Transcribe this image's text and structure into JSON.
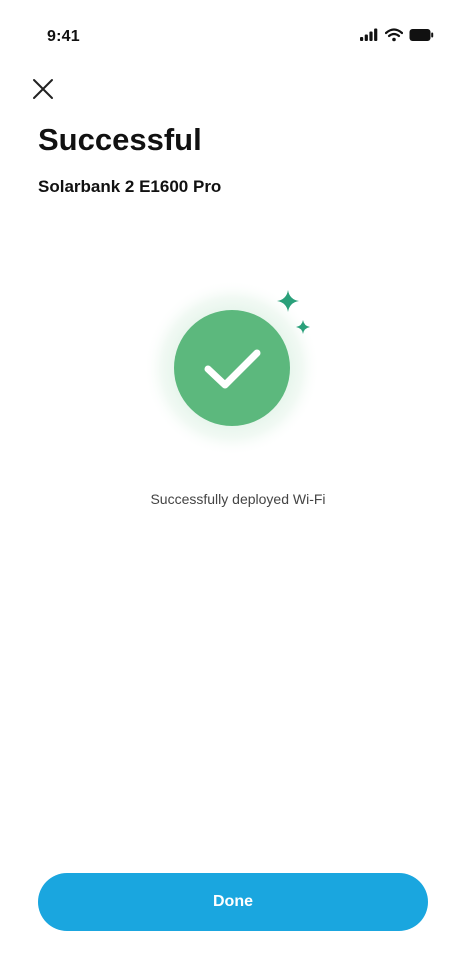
{
  "status_bar": {
    "time": "9:41",
    "icons": [
      "signal-icon",
      "wifi-icon",
      "battery-icon"
    ]
  },
  "header": {
    "close_icon": "close-icon",
    "title": "Successful",
    "device_name": "Solarbank 2 E1600 Pro"
  },
  "result": {
    "icon": "checkmark-icon",
    "sparkle_icon": "sparkle-icon",
    "message": "Successfully deployed Wi-Fi"
  },
  "footer": {
    "done_label": "Done"
  },
  "colors": {
    "accent": "#1aa6df",
    "success_green": "#5cb87d",
    "sparkle": "#2aa07a",
    "glow": "#e3f4ea"
  }
}
